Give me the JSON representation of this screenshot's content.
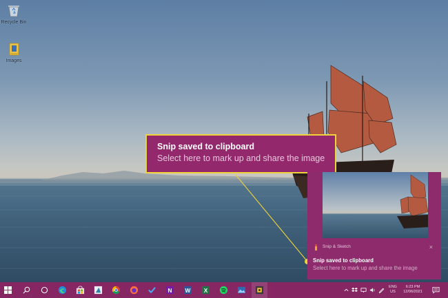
{
  "desktop": {
    "icons": [
      {
        "label": "Recycle Bin",
        "icon": "recycle-bin-icon"
      },
      {
        "label": "Images",
        "icon": "folder-icon"
      }
    ]
  },
  "callout": {
    "title": "Snip saved to clipboard",
    "subtitle": "Select here to mark up and share the image"
  },
  "toast": {
    "app_name": "Snip & Sketch",
    "close": "×",
    "title": "Snip saved to clipboard",
    "subtitle": "Select here to mark up and share the image"
  },
  "taskbar": {
    "apps": [
      "start",
      "search",
      "task-view",
      "edge",
      "store",
      "unknown-app",
      "chrome",
      "firefox",
      "todo",
      "onenote",
      "word",
      "excel",
      "spotify",
      "photos",
      "screen-capture"
    ],
    "tray": {
      "lang": "ENG",
      "region": "US",
      "time": "6:23 PM",
      "date": "12/06/2021"
    }
  },
  "colors": {
    "accent": "#862764",
    "callout_bg": "#93286d",
    "callout_border": "#f0d33a"
  }
}
